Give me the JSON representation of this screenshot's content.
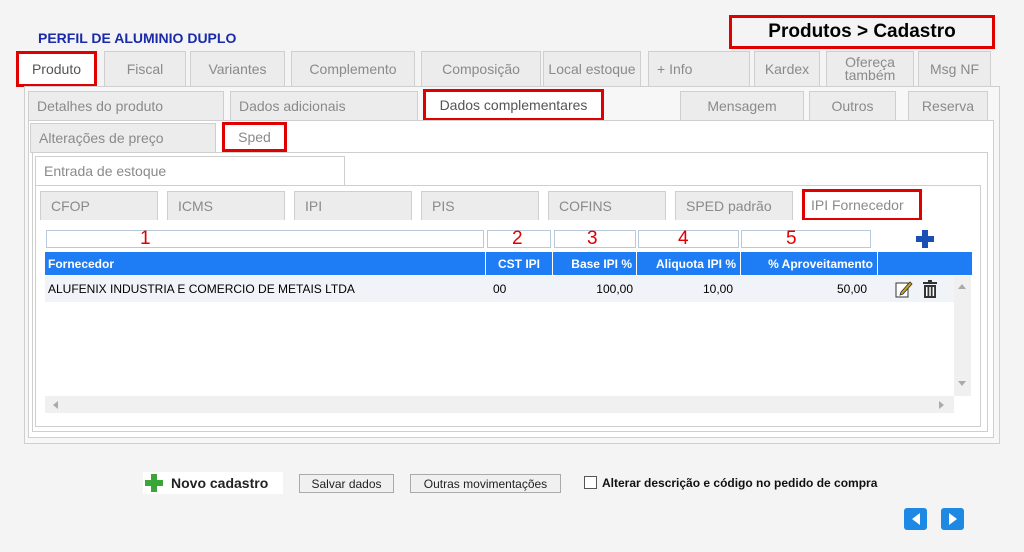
{
  "header": {
    "product_title": "PERFIL DE ALUMINIO DUPLO",
    "breadcrumb": "Produtos > Cadastro"
  },
  "main_tabs": [
    {
      "label": "Produto",
      "active": true,
      "highlighted": true
    },
    {
      "label": "Fiscal"
    },
    {
      "label": "Variantes"
    },
    {
      "label": "Complemento"
    },
    {
      "label": "Composição"
    },
    {
      "label": "Local estoque"
    },
    {
      "label": "+ Info"
    },
    {
      "label": "Kardex"
    },
    {
      "label": "Ofereça também"
    },
    {
      "label": "Msg NF"
    }
  ],
  "product_tabs": [
    {
      "label": "Detalhes do produto"
    },
    {
      "label": "Dados adicionais"
    },
    {
      "label": "Dados complementares",
      "active": true,
      "highlighted": true
    },
    {
      "label": "Mensagem"
    },
    {
      "label": "Outros"
    },
    {
      "label": "Reserva"
    },
    {
      "label": "Alterações de preço"
    },
    {
      "label": "Sped",
      "active": true,
      "highlighted": true
    }
  ],
  "sped_tab": {
    "label": "Entrada de estoque"
  },
  "tax_tabs": [
    {
      "label": "CFOP"
    },
    {
      "label": "ICMS"
    },
    {
      "label": "IPI"
    },
    {
      "label": "PIS"
    },
    {
      "label": "COFINS"
    },
    {
      "label": "SPED padrão"
    },
    {
      "label": "IPI Fornecedor",
      "active": true,
      "highlighted": true
    }
  ],
  "filter_numbers": [
    "1",
    "2",
    "3",
    "4",
    "5"
  ],
  "grid": {
    "columns": [
      "Fornecedor",
      "CST IPI",
      "Base IPI %",
      "Aliquota IPI %",
      "% Aproveitamento"
    ],
    "rows": [
      {
        "fornecedor": "ALUFENIX INDUSTRIA E COMERCIO DE METAIS LTDA",
        "cst_ipi": "00",
        "base_ipi": "100,00",
        "aliquota_ipi": "10,00",
        "aproveitamento": "50,00"
      }
    ]
  },
  "footer": {
    "new_label": "Novo cadastro",
    "save_label": "Salvar dados",
    "other_label": "Outras movimentações",
    "checkbox_label": "Alterar descrição e código no pedido de compra",
    "checkbox_checked": false
  },
  "colors": {
    "accent": "#1e7cf4",
    "annotation": "#e00000",
    "title": "#1a2aa8",
    "add_green": "#3aa63a"
  },
  "icons": {
    "add_row": "plus-icon",
    "edit": "edit-icon",
    "delete": "trash-icon",
    "prev": "prev-page-icon",
    "next": "next-page-icon"
  }
}
